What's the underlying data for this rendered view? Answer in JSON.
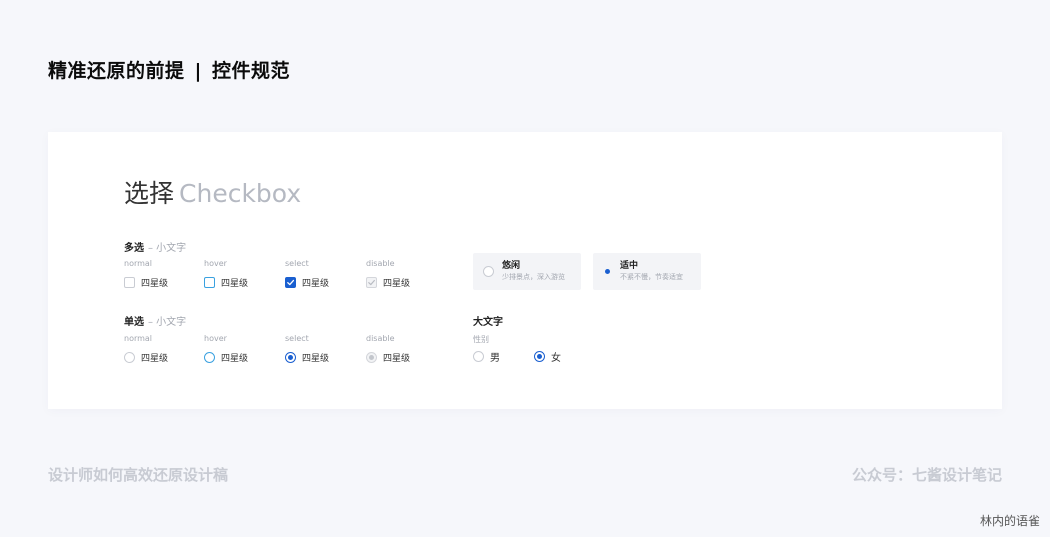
{
  "header": {
    "title_left": "精准还原的前提",
    "separator": "|",
    "title_right": "控件规范"
  },
  "card": {
    "title_cn": "选择",
    "title_en": "Checkbox",
    "checkbox_group": {
      "label": "多选",
      "sublabel": "– 小文字",
      "states": [
        "normal",
        "hover",
        "select",
        "disable"
      ],
      "item_label": "四星级"
    },
    "radio_group": {
      "label": "单选",
      "sublabel": "– 小文字",
      "states": [
        "normal",
        "hover",
        "select",
        "disable"
      ],
      "item_label": "四星级"
    },
    "card_options": [
      {
        "title": "悠闲",
        "desc": "少排景点，深入游览",
        "selected": false
      },
      {
        "title": "适中",
        "desc": "不紧不慢，节奏适宜",
        "selected": true
      }
    ],
    "large_group": {
      "label": "大文字",
      "field_label": "性别",
      "options": [
        {
          "label": "男",
          "selected": false
        },
        {
          "label": "女",
          "selected": true
        }
      ]
    }
  },
  "footer": {
    "left": "设计师如何高效还原设计稿",
    "right": "公众号：七酱设计笔记"
  },
  "watermark": "林内的语雀",
  "colors": {
    "accent": "#1a5fd0",
    "hover": "#3aa1e0",
    "background": "#f6f7fb"
  }
}
